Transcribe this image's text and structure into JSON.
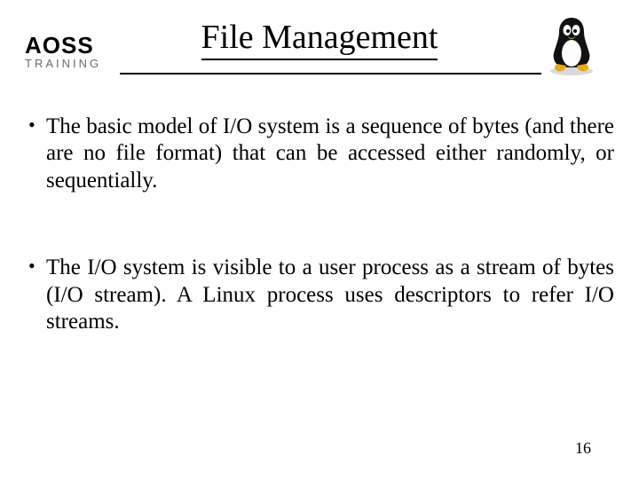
{
  "logo": {
    "line1": "AOSS",
    "line2": "TRAINING"
  },
  "title": "File Management",
  "bullets": [
    "The basic model of I/O system is a sequence of bytes (and there are no file format) that can be accessed either randomly, or sequentially.",
    "The I/O system is visible to a user process as a stream of bytes (I/O stream). A Linux process uses descriptors to refer I/O streams."
  ],
  "page_number": "16"
}
